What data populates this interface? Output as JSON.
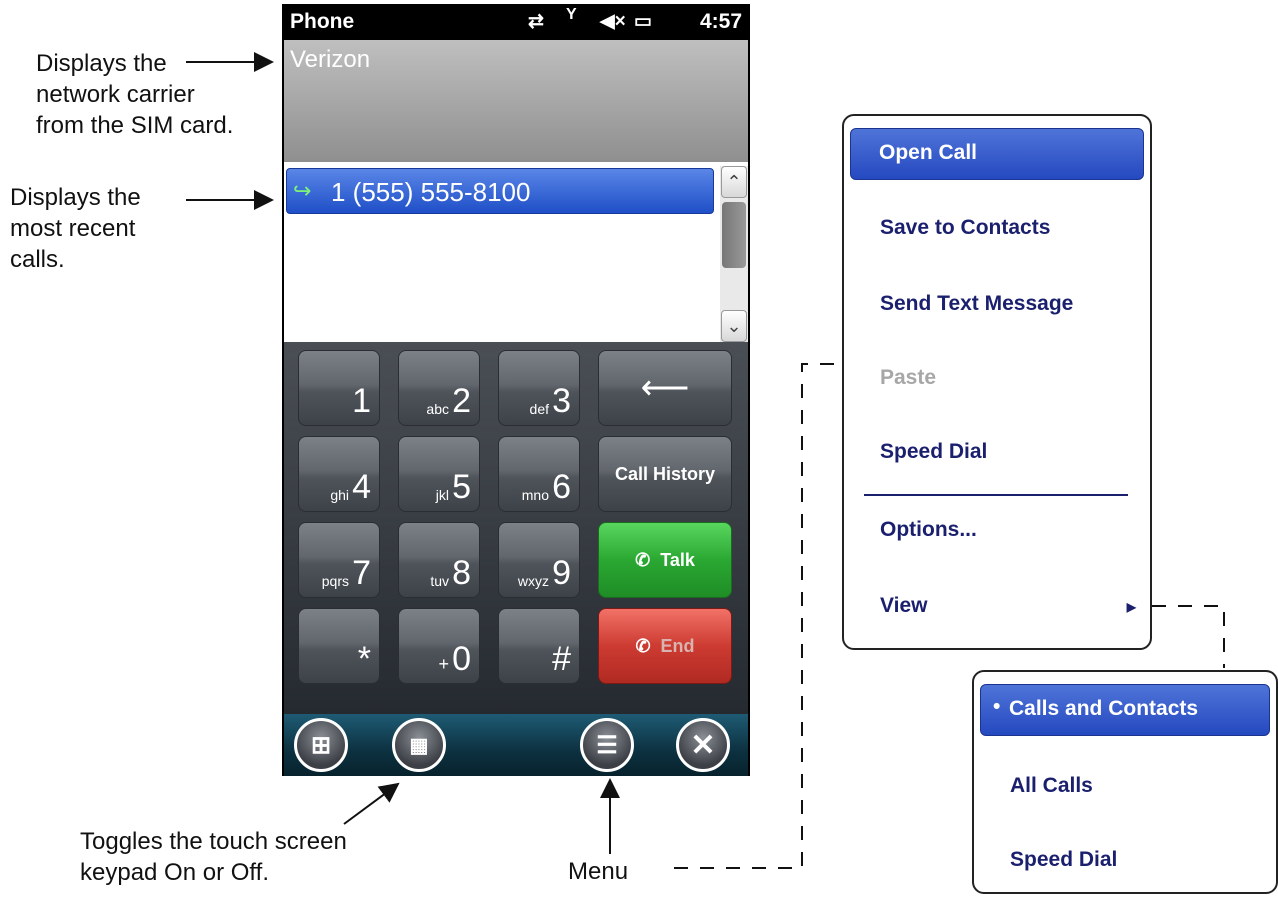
{
  "annotations": {
    "carrier_note": [
      "Displays the",
      "network carrier",
      "from the SIM card."
    ],
    "calls_note": [
      "Displays the",
      "most recent",
      "calls."
    ],
    "keypad_note": [
      "Toggles the touch screen",
      "keypad On or Off."
    ],
    "menu_note": "Menu"
  },
  "status_bar": {
    "title": "Phone",
    "time": "4:57",
    "icons": [
      "data-sync-icon",
      "signal-antenna-icon",
      "speaker-muted-icon",
      "battery-charging-icon"
    ]
  },
  "carrier": "Verizon",
  "recent_calls": [
    {
      "number": "1 (555) 555-8100",
      "type": "outgoing"
    }
  ],
  "keypad": {
    "keys": [
      {
        "sub": "",
        "num": "1"
      },
      {
        "sub": "abc",
        "num": "2"
      },
      {
        "sub": "def",
        "num": "3"
      },
      {
        "sub": "ghi",
        "num": "4"
      },
      {
        "sub": "jkl",
        "num": "5"
      },
      {
        "sub": "mno",
        "num": "6"
      },
      {
        "sub": "pqrs",
        "num": "7"
      },
      {
        "sub": "tuv",
        "num": "8"
      },
      {
        "sub": "wxyz",
        "num": "9"
      },
      {
        "sub": "",
        "num": "*"
      },
      {
        "sub": "+",
        "num": "0"
      },
      {
        "sub": "",
        "num": "#"
      }
    ],
    "backspace": "⟵",
    "call_history": "Call History",
    "talk": "Talk",
    "end": "End"
  },
  "context_menu": {
    "items": [
      "Open Call",
      "Save to Contacts",
      "Send Text Message",
      "Paste",
      "Speed Dial",
      "Options...",
      "View"
    ],
    "selected": "Open Call",
    "disabled": [
      "Paste"
    ]
  },
  "view_submenu": {
    "items": [
      "Calls and Contacts",
      "All Calls",
      "Speed Dial"
    ],
    "selected": "Calls and Contacts"
  }
}
